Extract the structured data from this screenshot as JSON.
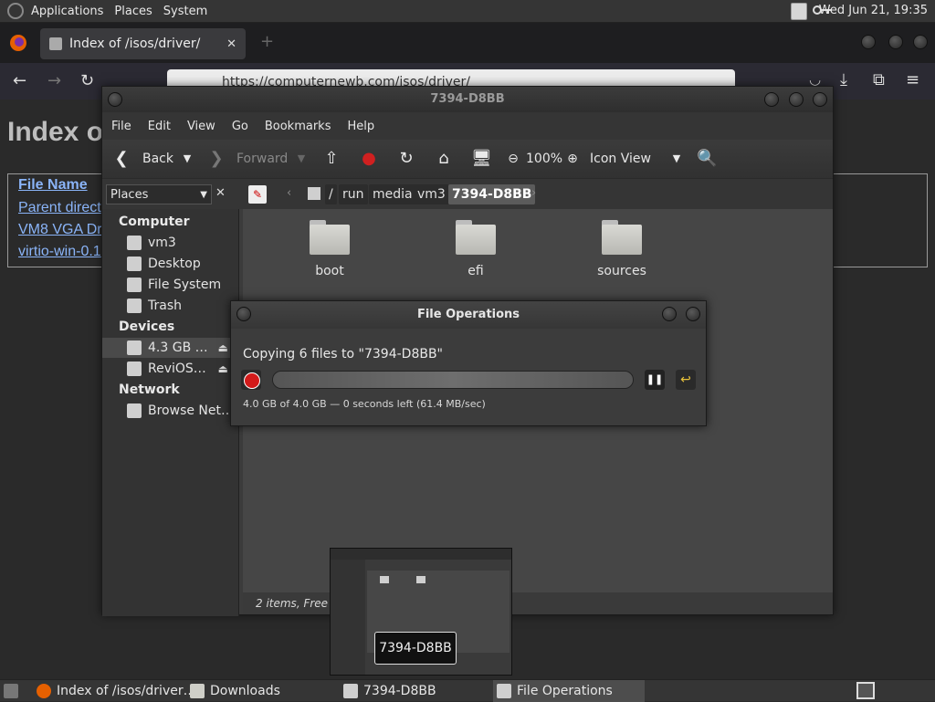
{
  "top_panel": {
    "menus": [
      "Applications",
      "Places",
      "System"
    ],
    "clock": "Wed Jun 21, 19:35"
  },
  "firefox": {
    "tab_title": "Index of /isos/driver/",
    "url": "https://computernewb.com/isos/driver/",
    "page_heading": "Index o",
    "table_header": "File Name",
    "links": [
      "Parent direct",
      "VM8 VGA Dr",
      "virtio-win-0.1"
    ]
  },
  "file_manager": {
    "title": "7394-D8BB",
    "menu": [
      "File",
      "Edit",
      "View",
      "Go",
      "Bookmarks",
      "Help"
    ],
    "toolbar": {
      "back": "Back",
      "forward": "Forward",
      "zoom": "100%",
      "view_mode": "Icon View"
    },
    "places_label": "Places",
    "breadcrumbs": [
      "/",
      "run",
      "media",
      "vm3",
      "7394-D8BB"
    ],
    "sidebar": {
      "computer_head": "Computer",
      "computer_items": [
        "vm3",
        "Desktop",
        "File System",
        "Trash"
      ],
      "devices_head": "Devices",
      "device_items": [
        "4.3 GB …",
        "ReviOS…"
      ],
      "network_head": "Network",
      "network_items": [
        "Browse Net…"
      ]
    },
    "folders": [
      "boot",
      "efi",
      "sources"
    ],
    "status": "2 items, Free spa"
  },
  "file_operations": {
    "title": "File Operations",
    "copying_text": "Copying 6 files to \"7394-D8BB\"",
    "progress": 1.0,
    "detail": "4.0 GB of 4.0 GB — 0 seconds left (61.4 MB/sec)"
  },
  "thumbnail_label": "7394-D8BB",
  "taskbar": {
    "tasks": [
      "Index of /isos/driver…",
      "Downloads",
      "7394-D8BB",
      "File Operations"
    ]
  }
}
